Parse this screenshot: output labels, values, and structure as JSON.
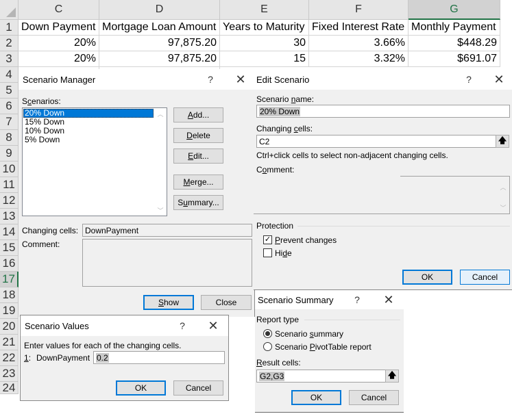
{
  "spreadsheet": {
    "columns": [
      {
        "letter": "C",
        "selected": false
      },
      {
        "letter": "D",
        "selected": false
      },
      {
        "letter": "E",
        "selected": false
      },
      {
        "letter": "F",
        "selected": false
      },
      {
        "letter": "G",
        "selected": true
      }
    ],
    "rows": [
      "1",
      "2",
      "3",
      "4",
      "5",
      "6",
      "7",
      "8",
      "9",
      "10",
      "11",
      "12",
      "13",
      "14",
      "15",
      "16",
      "17",
      "18",
      "19",
      "20",
      "21",
      "22",
      "23",
      "24"
    ],
    "selected_row": "17",
    "headers": [
      "Down Payment",
      "Mortgage Loan Amount",
      "Years to Maturity",
      "Fixed Interest Rate",
      "Monthly Payment"
    ],
    "data": [
      [
        "20%",
        "97,875.20",
        "30",
        "3.66%",
        "$448.29"
      ],
      [
        "20%",
        "97,875.20",
        "15",
        "3.32%",
        "$691.07"
      ]
    ]
  },
  "scenario_manager": {
    "title": "Scenario Manager",
    "help": "?",
    "close": "✕",
    "scenarios_label_pre": "S",
    "scenarios_label_ul": "c",
    "scenarios_label_post": "enarios:",
    "scenarios": [
      "20% Down",
      "15% Down",
      "10% Down",
      "5% Down"
    ],
    "selected_index": 0,
    "buttons": {
      "add": {
        "ul": "A",
        "rest": "dd..."
      },
      "delete": {
        "ul": "D",
        "rest": "elete"
      },
      "edit": {
        "ul": "E",
        "rest": "dit..."
      },
      "merge": {
        "ul": "M",
        "rest": "erge..."
      },
      "summary": {
        "pre": "S",
        "ul": "u",
        "rest": "mmary..."
      },
      "show": {
        "ul": "S",
        "rest": "how"
      },
      "close": "Close"
    },
    "changing_cells_label": "Changing cells:",
    "changing_cells_value": "DownPayment",
    "comment_label": "Comment:",
    "comment_value": ""
  },
  "edit_scenario": {
    "title": "Edit Scenario",
    "help": "?",
    "close": "✕",
    "name_label_pre": "Scenario ",
    "name_label_ul": "n",
    "name_label_post": "ame:",
    "name_value": "20% Down",
    "changing_label_pre": "Changing ",
    "changing_label_ul": "c",
    "changing_label_post": "ells:",
    "changing_value": "C2",
    "hint": "Ctrl+click cells to select non-adjacent changing cells.",
    "comment_label_pre": "C",
    "comment_label_ul": "o",
    "comment_label_post": "mment:",
    "comment_value": "",
    "protection_label": "Protection",
    "prevent_changes": {
      "ul": "P",
      "rest": "revent changes",
      "checked": true
    },
    "hide": {
      "pre": "Hi",
      "ul": "d",
      "rest": "e",
      "checked": false
    },
    "ok": "OK",
    "cancel": "Cancel"
  },
  "scenario_values": {
    "title": "Scenario Values",
    "help": "?",
    "close": "✕",
    "instruction": "Enter values for each of the changing cells.",
    "index_ul": "1",
    "index_rest": ":",
    "cell_name": "DownPayment",
    "value": "0.2",
    "ok": "OK",
    "cancel": "Cancel"
  },
  "scenario_summary": {
    "title": "Scenario Summary",
    "help": "?",
    "close": "✕",
    "report_type_label": "Report type",
    "option_summary": {
      "pre": "Scenario ",
      "ul": "s",
      "rest": "ummary",
      "selected": true
    },
    "option_pivot": {
      "pre": "Scenario ",
      "ul": "P",
      "rest": "ivotTable report",
      "selected": false
    },
    "result_label_ul": "R",
    "result_label_rest": "esult cells:",
    "result_value": "G2,G3",
    "ok": "OK",
    "cancel": "Cancel"
  }
}
